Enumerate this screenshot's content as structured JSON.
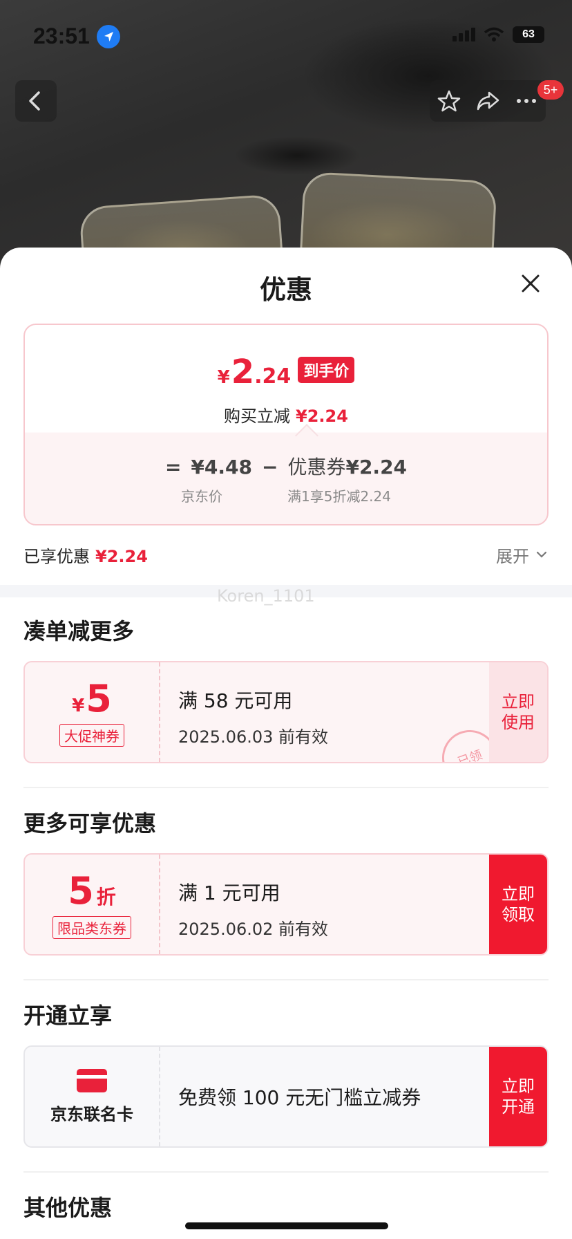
{
  "status_bar": {
    "time": "23:51",
    "battery": "63"
  },
  "nav": {
    "notification_badge": "5+"
  },
  "sheet": {
    "title": "优惠",
    "price_card": {
      "currency": "¥",
      "price_int": "2",
      "price_dec": ".24",
      "final_price_tag": "到手价",
      "reduce_label": "购买立减",
      "reduce_value": "¥2.24",
      "eq_sign": "=",
      "jd_price": "¥4.48",
      "minus_sign": "−",
      "coupon_label": "优惠券",
      "coupon_value": "¥2.24",
      "jd_price_caption": "京东价",
      "coupon_caption": "满1享5折减2.24"
    },
    "enjoyed": {
      "label": "已享优惠",
      "value": "¥2.24",
      "expand_label": "展开"
    },
    "watermark": "Koren_1101",
    "sections": {
      "combine": {
        "title": "凑单减更多",
        "coupon": {
          "yen": "¥",
          "amount": "5",
          "tag": "大促神券",
          "condition": "满 58 元可用",
          "valid_until": "2025.06.03 前有效",
          "button": "立即使用",
          "stamp": "已领"
        }
      },
      "more": {
        "title": "更多可享优惠",
        "coupon": {
          "amount": "5",
          "unit": "折",
          "tag": "限品类东券",
          "condition": "满 1 元可用",
          "valid_until": "2025.06.02 前有效",
          "button": "立即领取"
        }
      },
      "open": {
        "title": "开通立享",
        "card": {
          "name": "京东联名卡",
          "desc": "免费领 100 元无门槛立减券",
          "button": "立即开通"
        }
      },
      "other": {
        "title": "其他优惠"
      }
    }
  },
  "colors": {
    "accent_red": "#e9213a",
    "button_red": "#f0192f",
    "ios_blue": "#1f7cf4"
  }
}
